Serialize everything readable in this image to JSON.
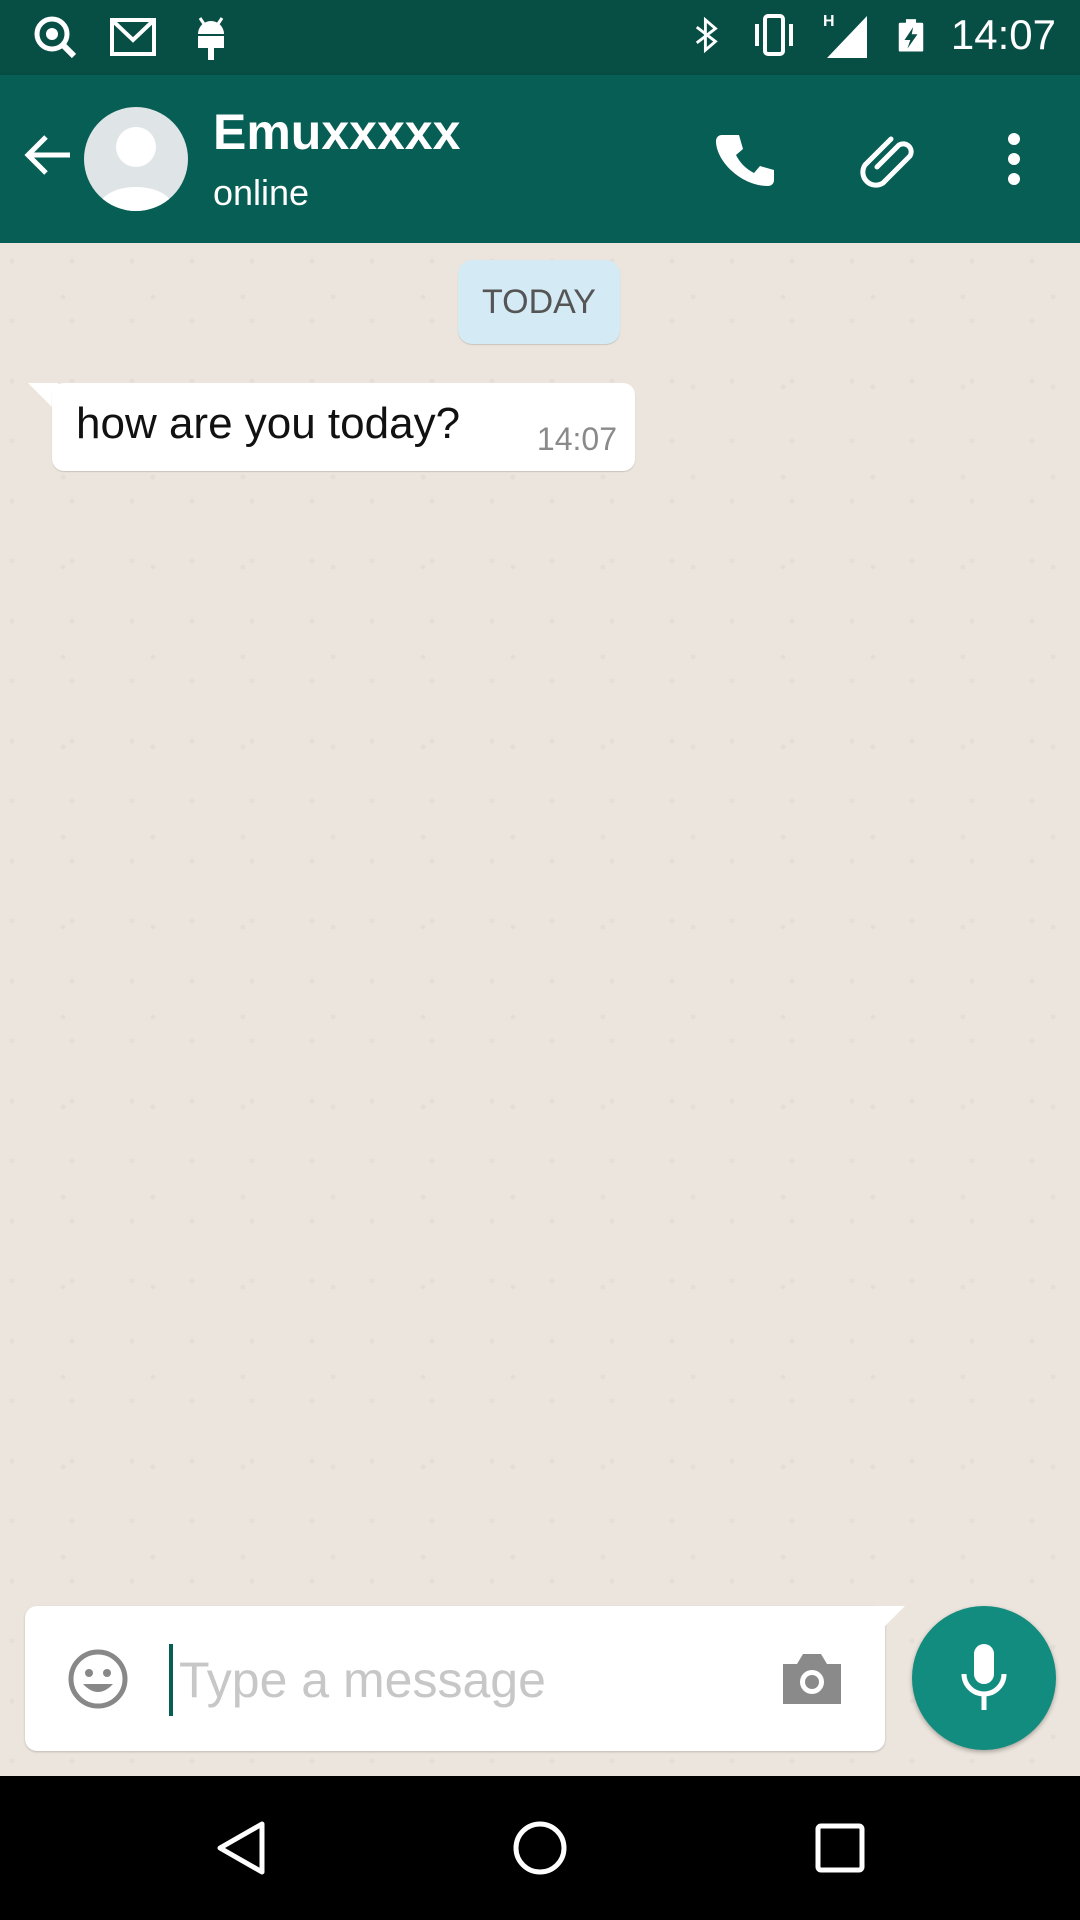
{
  "status_bar": {
    "time": "14:07",
    "left_icons": [
      "search-notification-icon",
      "gmail-icon",
      "android-icon"
    ],
    "right_icons": [
      "bluetooth-icon",
      "vibrate-icon",
      "signal-h-icon",
      "battery-charging-icon"
    ]
  },
  "header": {
    "contact_name": "Emuxxxxx",
    "contact_status": "online",
    "actions": [
      "call-icon",
      "attach-icon",
      "more-options-icon"
    ],
    "colors": {
      "bar": "#075e54",
      "status_bar": "#074e45"
    }
  },
  "chat": {
    "date_chip": "TODAY",
    "messages": [
      {
        "direction": "incoming",
        "text": "how are you today?",
        "time": "14:07"
      }
    ]
  },
  "composer": {
    "placeholder": "Type a message",
    "value": "",
    "accent": "#128c7e"
  },
  "navigation": {
    "buttons": [
      "back-nav-icon",
      "home-nav-icon",
      "recents-nav-icon"
    ]
  }
}
